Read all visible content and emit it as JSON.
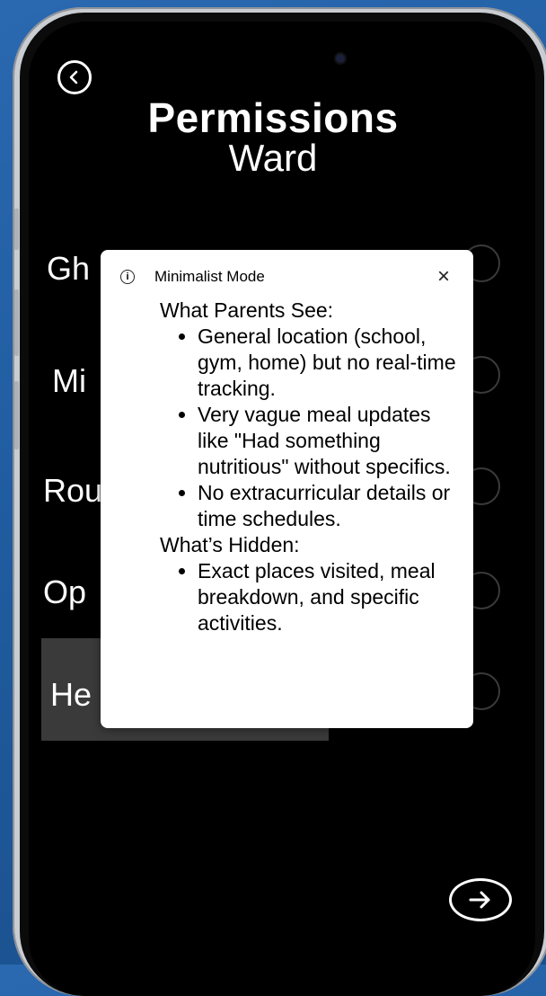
{
  "header": {
    "title": "Permissions",
    "subtitle": "Ward"
  },
  "options": [
    {
      "label": "Gh"
    },
    {
      "label": "Mi"
    },
    {
      "label": "Rou"
    },
    {
      "label": "Op"
    },
    {
      "label": "He"
    }
  ],
  "popup": {
    "title": "Minimalist Mode",
    "close_label": "×",
    "sections": [
      {
        "heading": "What Parents See:",
        "items": [
          "General location (school, gym, home) but no real-time tracking.",
          "Very vague meal updates like \"Had something nutritious\" without specifics.",
          "No extracurricular details or time schedules."
        ]
      },
      {
        "heading": "What’s Hidden:",
        "items": [
          "Exact places visited, meal breakdown, and specific activities."
        ]
      }
    ]
  },
  "icons": {
    "back": "back-arrow-circle-icon",
    "next": "next-arrow-circle-icon",
    "info": "info-icon",
    "close": "close-icon"
  },
  "colors": {
    "background": "#1f5c9f",
    "screen": "#000000",
    "popup": "#ffffff",
    "highlight": "#3a3a3a"
  }
}
